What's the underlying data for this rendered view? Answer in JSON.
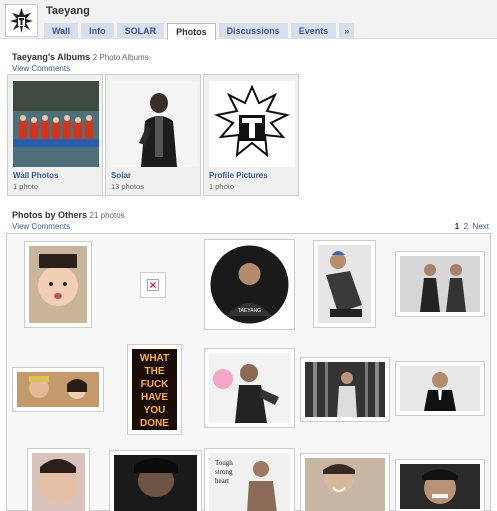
{
  "page": {
    "title": "Taeyang"
  },
  "tabs": [
    {
      "label": "Wall",
      "active": false
    },
    {
      "label": "Info",
      "active": false
    },
    {
      "label": "SOLAR",
      "active": false
    },
    {
      "label": "Photos",
      "active": true
    },
    {
      "label": "Discussions",
      "active": false
    },
    {
      "label": "Events",
      "active": false
    },
    {
      "label": "»",
      "active": false
    }
  ],
  "albums_section": {
    "title": "Taeyang's Albums",
    "count": "2 Photo Albums",
    "view_comments": "View Comments",
    "albums": [
      {
        "title": "Wall Photos",
        "count": "1 photo"
      },
      {
        "title": "Solar",
        "count": "13 photos"
      },
      {
        "title": "Profile Pictures",
        "count": "1 photo"
      }
    ]
  },
  "others_section": {
    "title": "Photos by Others",
    "count": "21 photos",
    "view_comments": "View Comments",
    "pagination": {
      "page1": "1",
      "page2": "2",
      "next": "Next"
    }
  },
  "photo_text": {
    "sign_lines": [
      "WHAT",
      "THE",
      "FUCK",
      "HAVE",
      "YOU",
      "DONE"
    ],
    "tough_lines": [
      "Tough",
      "strong",
      "heart"
    ],
    "taeyang_caption": "TAEYANG"
  },
  "colors": {
    "link": "#3b5998",
    "tab_bg": "#d8dfea"
  }
}
